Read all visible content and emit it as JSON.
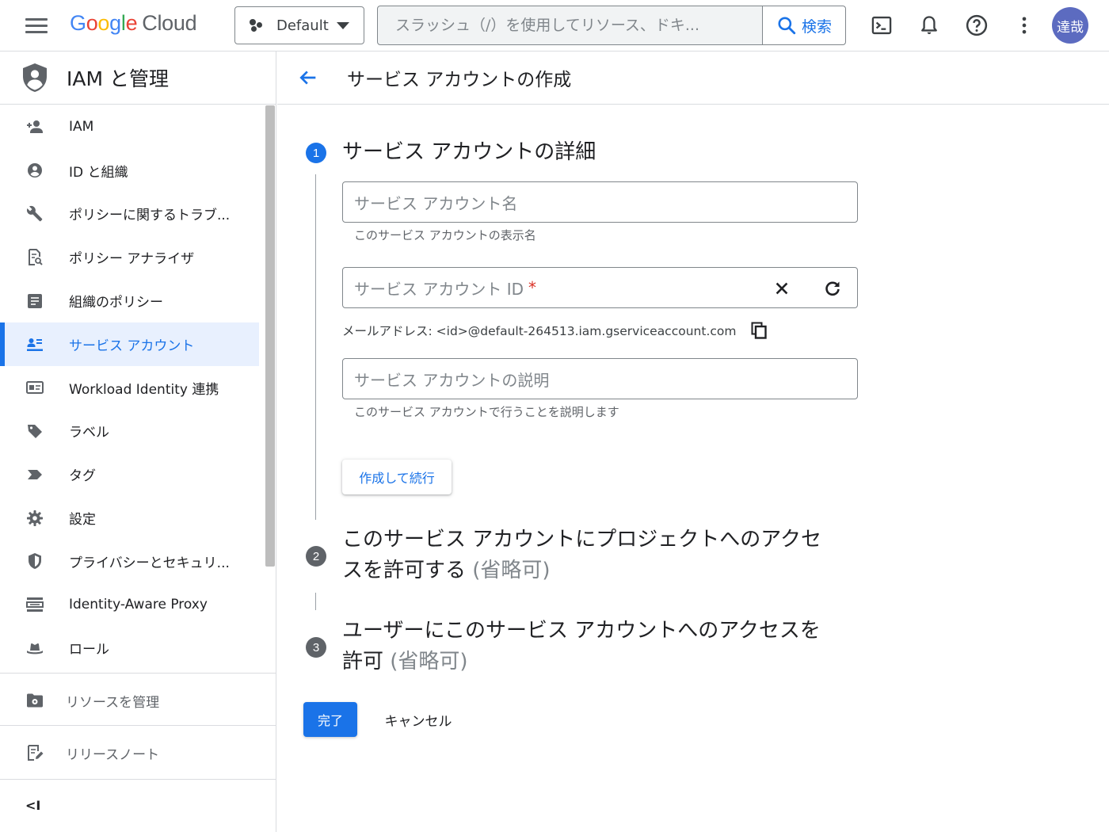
{
  "topbar": {
    "logo_google": "Google",
    "logo_cloud": "Cloud",
    "project": "Default",
    "search_placeholder": "スラッシュ（/）を使用してリソース、ドキ...",
    "search_button": "検索",
    "avatar_text": "達哉"
  },
  "sidebar": {
    "title": "IAM と管理",
    "items": [
      {
        "label": "IAM",
        "icon": "person-add-icon"
      },
      {
        "label": "ID と組織",
        "icon": "account-circle-icon"
      },
      {
        "label": "ポリシーに関するトラブ...",
        "icon": "wrench-icon"
      },
      {
        "label": "ポリシー アナライザ",
        "icon": "policy-analyzer-icon"
      },
      {
        "label": "組織のポリシー",
        "icon": "list-icon"
      },
      {
        "label": "サービス アカウント",
        "icon": "service-account-icon",
        "active": true
      },
      {
        "label": "Workload Identity 連携",
        "icon": "id-card-icon"
      },
      {
        "label": "ラベル",
        "icon": "label-icon"
      },
      {
        "label": "タグ",
        "icon": "tag-icon"
      },
      {
        "label": "設定",
        "icon": "gear-icon"
      },
      {
        "label": "プライバシーとセキュリ...",
        "icon": "shield-icon"
      },
      {
        "label": "Identity-Aware Proxy",
        "icon": "proxy-icon"
      },
      {
        "label": "ロール",
        "icon": "hat-icon"
      }
    ],
    "manage_resources": "リソースを管理",
    "release_notes": "リリースノート",
    "collapse": "<I"
  },
  "main": {
    "title": "サービス アカウントの作成",
    "step1": {
      "num": "1",
      "title": "サービス アカウントの詳細",
      "name_placeholder": "サービス アカウント名",
      "name_hint": "このサービス アカウントの表示名",
      "id_placeholder": "サービス アカウント ID",
      "id_required": "*",
      "email": "メールアドレス: <id>@default-264513.iam.gserviceaccount.com",
      "desc_placeholder": "サービス アカウントの説明",
      "desc_hint": "このサービス アカウントで行うことを説明します",
      "create_button": "作成して続行"
    },
    "step2": {
      "num": "2",
      "title_line1": "このサービス アカウントにプロジェクトへのアクセ",
      "title_line2": "スを許可する",
      "optional": "(省略可)"
    },
    "step3": {
      "num": "3",
      "title_line1": "ユーザーにこのサービス アカウントへのアクセスを",
      "title_line2": "許可",
      "optional": "(省略可)"
    },
    "done_button": "完了",
    "cancel_button": "キャンセル"
  },
  "colors": {
    "accent": "#1a73e8",
    "active_bg": "#e8f0fe",
    "required": "#d93025"
  }
}
